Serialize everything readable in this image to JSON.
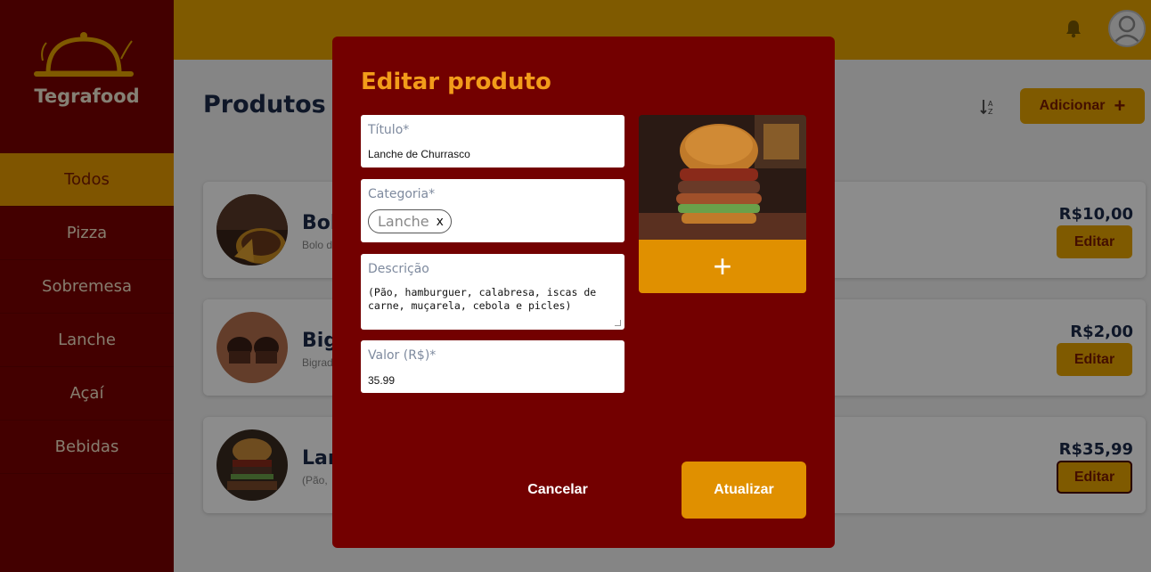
{
  "app": {
    "brand": "Tegrafood"
  },
  "sidebar": {
    "items": [
      {
        "label": "Todos",
        "active": true
      },
      {
        "label": "Pizza"
      },
      {
        "label": "Sobremesa"
      },
      {
        "label": "Lanche"
      },
      {
        "label": "Açaí"
      },
      {
        "label": "Bebidas"
      }
    ]
  },
  "header": {
    "bell_icon": "bell-icon",
    "avatar_icon": "user-avatar-icon"
  },
  "page": {
    "title": "Produtos",
    "add_label": "Adicionar",
    "add_icon": "+"
  },
  "products": [
    {
      "name": "Bol",
      "desc": "Bolo d",
      "price": "R$10,00",
      "edit_label": "Editar"
    },
    {
      "name": "Big",
      "desc": "Bigrad",
      "price": "R$2,00",
      "edit_label": "Editar"
    },
    {
      "name": "Lan",
      "desc": "(Pão, ",
      "price": "R$35,99",
      "edit_label": "Editar"
    }
  ],
  "modal": {
    "title": "Editar produto",
    "title_field": {
      "label": "Título*",
      "value": "Lanche de Churrasco"
    },
    "category_field": {
      "label": "Categoria*",
      "chip": "Lanche",
      "chip_remove": "x"
    },
    "description_field": {
      "label": "Descrição",
      "value": "(Pão, hamburguer, calabresa, iscas de carne, muçarela, cebola e picles)"
    },
    "price_field": {
      "label": "Valor (R$)*",
      "value": "35.99"
    },
    "image_add_icon": "+",
    "cancel_label": "Cancelar",
    "update_label": "Atualizar"
  },
  "colors": {
    "sidebar": "#7a0000",
    "accent": "#e8a400",
    "modal": "#730000",
    "title_orange": "#f29c1a"
  }
}
